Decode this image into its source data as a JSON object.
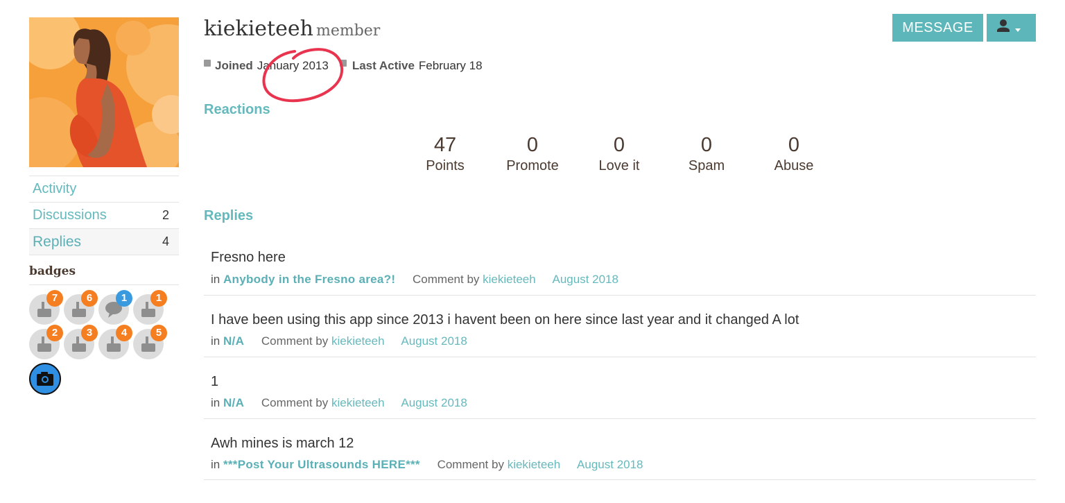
{
  "profile": {
    "username": "kiekieteeh",
    "rank": "member",
    "joined_label": "Joined",
    "joined_value": "January 2013",
    "last_active_label": "Last Active",
    "last_active_value": "February 18",
    "message_button": "MESSAGE",
    "user_menu_icon": "user-icon"
  },
  "sidebar": {
    "items": [
      {
        "label": "Activity",
        "count": ""
      },
      {
        "label": "Discussions",
        "count": "2"
      },
      {
        "label": "Replies",
        "count": "4"
      }
    ],
    "badges_title": "badges",
    "badges": [
      {
        "icon": "stand-icon",
        "count": "7"
      },
      {
        "icon": "stand-icon",
        "count": "6"
      },
      {
        "icon": "comment-icon",
        "count": "1"
      },
      {
        "icon": "stand-icon",
        "count": "1"
      },
      {
        "icon": "stand-icon",
        "count": "2"
      },
      {
        "icon": "stand-icon",
        "count": "3"
      },
      {
        "icon": "stand-icon",
        "count": "4"
      },
      {
        "icon": "stand-icon",
        "count": "5"
      }
    ],
    "camera_badge_icon": "camera-icon"
  },
  "reactions": {
    "title": "Reactions",
    "stats": [
      {
        "value": "47",
        "label": "Points"
      },
      {
        "value": "0",
        "label": "Promote"
      },
      {
        "value": "0",
        "label": "Love it"
      },
      {
        "value": "0",
        "label": "Spam"
      },
      {
        "value": "0",
        "label": "Abuse"
      }
    ]
  },
  "replies": {
    "title": "Replies",
    "items": [
      {
        "body": "Fresno here",
        "in": "in",
        "discussion": "Anybody in the Fresno area?!",
        "comment_by": "Comment by",
        "author": "kiekieteeh",
        "date": "August 2018"
      },
      {
        "body": "I have been using this app since 2013 i havent been on here since last year and it changed A lot",
        "in": "in",
        "discussion": "N/A",
        "comment_by": "Comment by",
        "author": "kiekieteeh",
        "date": "August 2018"
      },
      {
        "body": "1",
        "in": "in",
        "discussion": "N/A",
        "comment_by": "Comment by",
        "author": "kiekieteeh",
        "date": "August 2018"
      },
      {
        "body": "Awh mines is march 12",
        "in": "in",
        "discussion": "***Post Your Ultrasounds HERE***",
        "comment_by": "Comment by",
        "author": "kiekieteeh",
        "date": "August 2018"
      }
    ]
  },
  "colors": {
    "accent": "#5cb6ba",
    "badge_orange": "#f47e20",
    "badge_blue": "#3a9ae0",
    "annotation_red": "#e8344e"
  }
}
